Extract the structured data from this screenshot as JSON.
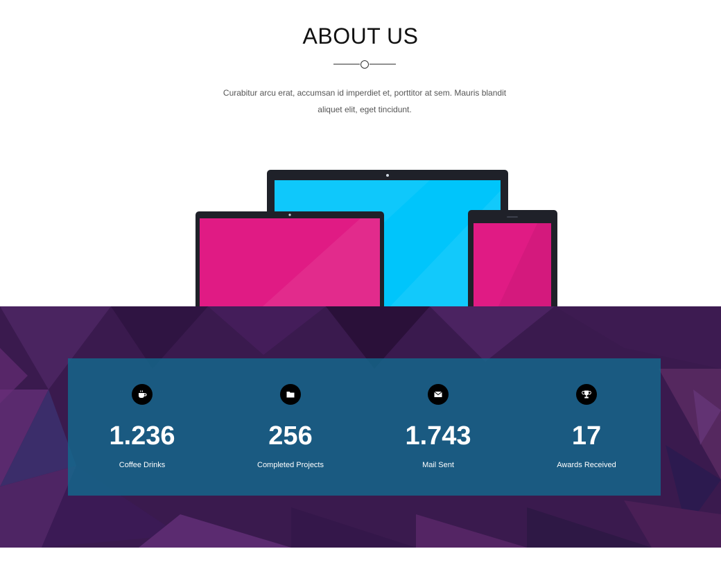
{
  "about": {
    "title": "ABOUT US",
    "intro_line1": "Curabitur arcu erat, accumsan id imperdiet et, porttitor at sem. Mauris blandit",
    "intro_line2": "aliquet elit, eget tincidunt."
  },
  "colors": {
    "laptop_screen": "#00c5fb",
    "tablet_screen": "#e01b84",
    "device_frame": "#1f2129",
    "stats_box": "#14698c",
    "band_base": "#3a1a4e"
  },
  "stats": [
    {
      "icon": "coffee-icon",
      "value": "1.236",
      "label": "Coffee Drinks"
    },
    {
      "icon": "folder-icon",
      "value": "256",
      "label": "Completed Projects"
    },
    {
      "icon": "envelope-icon",
      "value": "1.743",
      "label": "Mail Sent"
    },
    {
      "icon": "trophy-icon",
      "value": "17",
      "label": "Awards Received"
    }
  ]
}
